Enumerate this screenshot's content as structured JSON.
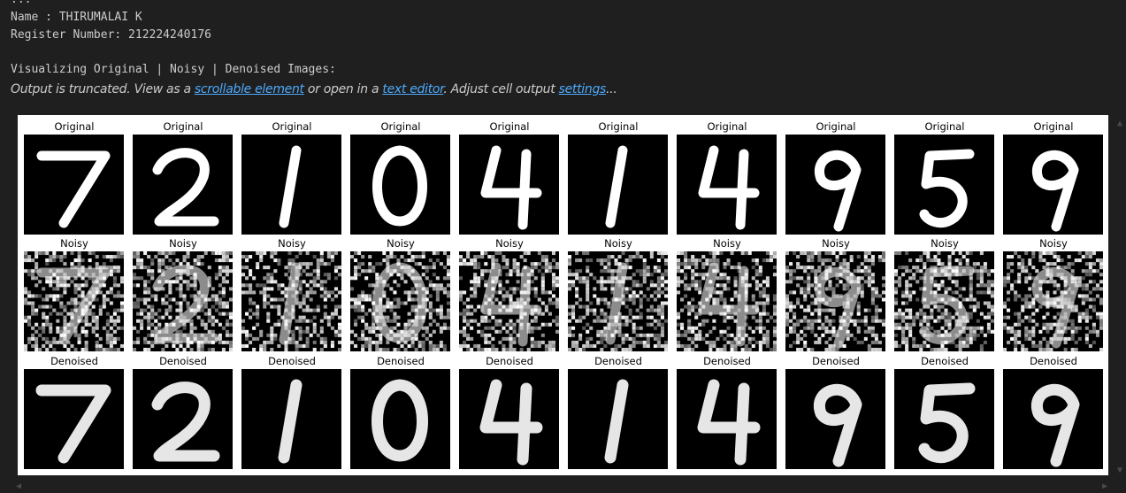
{
  "output": {
    "ellipsis": "...",
    "name_line": "Name : THIRUMALAI K",
    "register_line": "Register Number: 212224240176",
    "visualizing_line": "Visualizing Original | Noisy | Denoised Images:"
  },
  "truncation": {
    "prefix": "Output is truncated. View as a ",
    "scrollable_link": "scrollable element",
    "middle": " or open in a ",
    "editor_link": "text editor",
    "middle2": ". Adjust cell output ",
    "settings_link": "settings",
    "suffix": "..."
  },
  "figure": {
    "row_titles": [
      "Original",
      "Noisy",
      "Denoised"
    ],
    "digits": [
      "7",
      "2",
      "1",
      "0",
      "4",
      "1",
      "4",
      "9",
      "5",
      "9"
    ]
  },
  "colors": {
    "background": "#1f1f1f",
    "text": "#cccccc",
    "link": "#4daafc"
  },
  "icons": {
    "scroll_up": "scroll-up-icon",
    "scroll_down": "scroll-down-icon"
  }
}
